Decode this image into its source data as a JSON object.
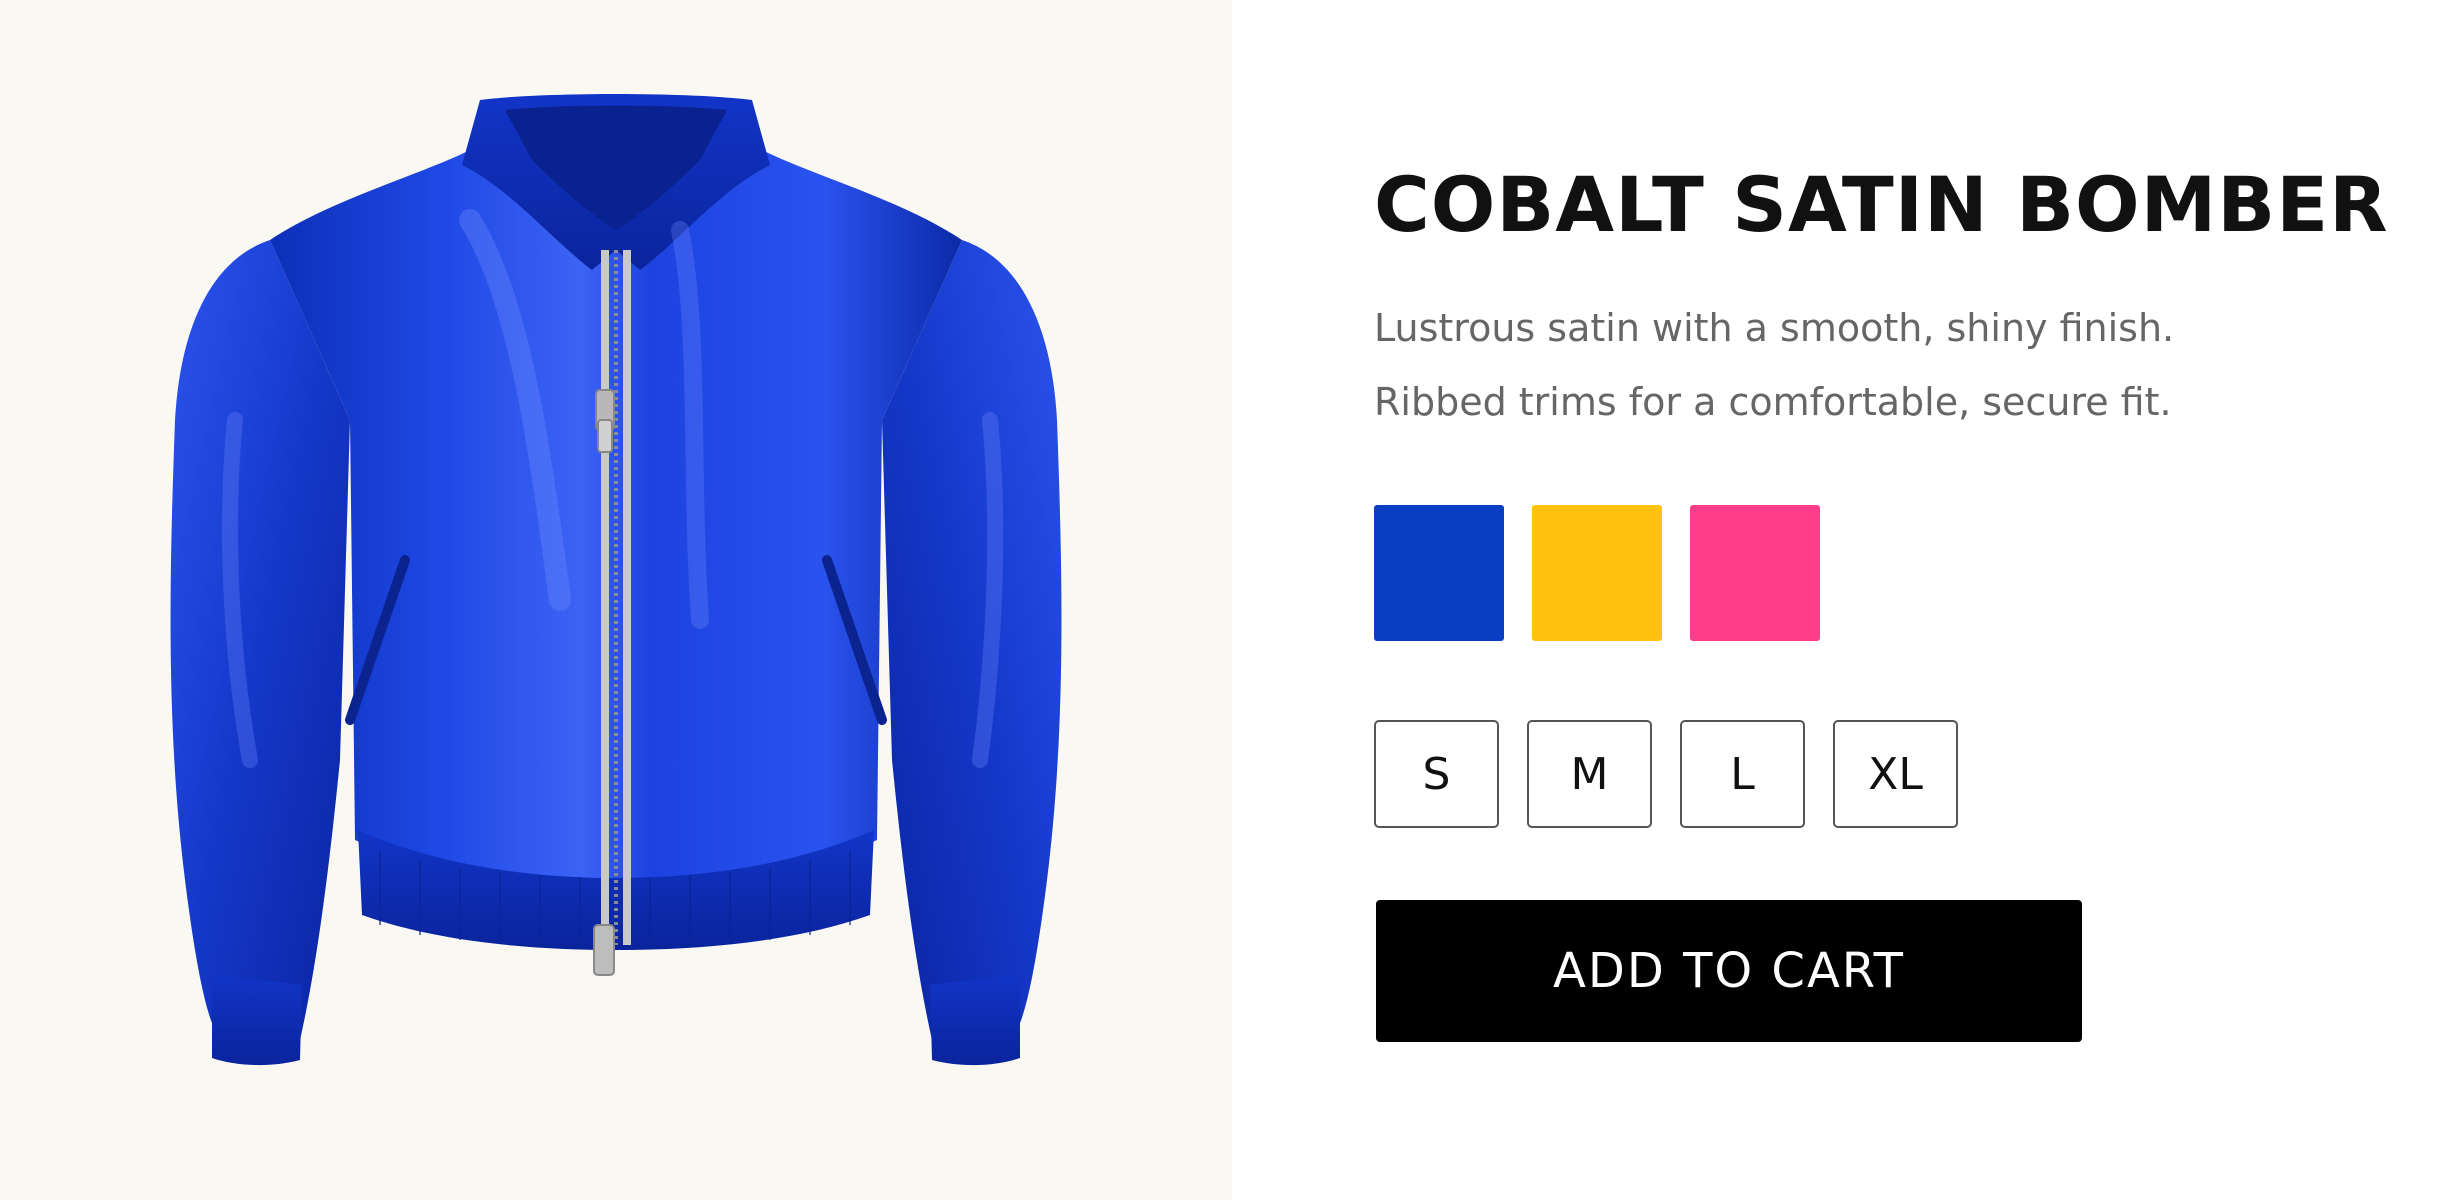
{
  "product": {
    "title": "COBALT SATIN BOMBER",
    "description_lines": [
      "Lustrous satin with a smooth, shiny finish.",
      "Ribbed trims for a comfortable, secure fit."
    ],
    "image_icon": "jacket-photo"
  },
  "colors": [
    {
      "name": "cobalt",
      "hex": "#0a3fc4"
    },
    {
      "name": "yellow",
      "hex": "#ffc20e"
    },
    {
      "name": "pink",
      "hex": "#ff3d8b"
    }
  ],
  "sizes": [
    "S",
    "M",
    "L",
    "XL"
  ],
  "cart": {
    "add_label": "ADD TO CART"
  }
}
